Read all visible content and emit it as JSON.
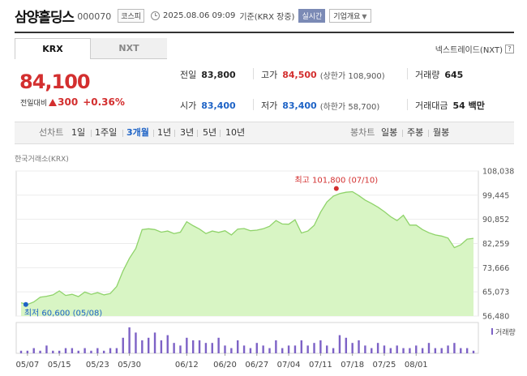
{
  "header": {
    "company": "삼양홀딩스",
    "code": "000070",
    "market": "코스피",
    "datetime": "2025.08.06 09:09",
    "basis": "기준(KRX 장중)",
    "realtime": "실시간",
    "company_info": "기업개요"
  },
  "tabs": {
    "krx": "KRX",
    "nxt": "NXT"
  },
  "nextrade": "넥스트레이드(NXT)",
  "price": {
    "current": "84,100",
    "change_label": "전일대비",
    "change": "300",
    "change_pct": "+0.36%"
  },
  "stats": {
    "prev_label": "전일",
    "prev": "83,800",
    "high_label": "고가",
    "high": "84,500",
    "upper_limit": "(상한가 108,900)",
    "volume_label": "거래량",
    "volume": "645",
    "open_label": "시가",
    "open": "83,400",
    "low_label": "저가",
    "low": "83,400",
    "lower_limit": "(하한가 58,700)",
    "amount_label": "거래대금",
    "amount": "54 백만"
  },
  "period_bar": {
    "line_label": "선차트",
    "periods": [
      "1일",
      "1주일",
      "3개월",
      "1년",
      "3년",
      "5년",
      "10년"
    ],
    "active_period": "3개월",
    "candle_label": "봉차트",
    "candles": [
      "일봉",
      "주봉",
      "월봉"
    ]
  },
  "colors": {
    "up": "#d32f2f",
    "down": "#1e63c6",
    "area": "#9be07a",
    "volume": "#7d62c6"
  },
  "chart_data": {
    "type": "area",
    "source": "한국거래소(KRX)",
    "y_ticks": [
      "108,038",
      "99,445",
      "90,852",
      "82,259",
      "73,666",
      "65,073",
      "56,480"
    ],
    "ylim": [
      56480,
      108038
    ],
    "x_ticks": [
      "05/07",
      "05/15",
      "05/23",
      "05/30",
      "06/12",
      "06/20",
      "06/27",
      "07/04",
      "07/11",
      "07/18",
      "07/25",
      "08/01"
    ],
    "series": [
      {
        "values": [
          61200,
          60600,
          61500,
          63200,
          63500,
          64000,
          65400,
          63800,
          64200,
          63400,
          65000,
          64200,
          64800,
          64000,
          64500,
          67000,
          72500,
          77000,
          80500,
          87200,
          87500,
          87200,
          86300,
          86700,
          85800,
          86300,
          90000,
          88600,
          87400,
          85800,
          86700,
          86200,
          86800,
          85300,
          87400,
          87600,
          86800,
          87000,
          87500,
          88400,
          90400,
          89200,
          89100,
          90700,
          86000,
          86700,
          88700,
          93400,
          97000,
          99100,
          100000,
          100500,
          100700,
          99300,
          97700,
          96500,
          95200,
          93600,
          91800,
          90400,
          92300,
          88800,
          88800,
          87200,
          86100,
          85300,
          84900,
          84200,
          80800,
          81800,
          83800,
          84100
        ]
      }
    ],
    "volume_label": "거래량",
    "volume": [
      1,
      1,
      2,
      1,
      3,
      1,
      1,
      2,
      2,
      1,
      2,
      1,
      2,
      1,
      2,
      2,
      6,
      10,
      8,
      5,
      6,
      8,
      5,
      7,
      4,
      3,
      6,
      5,
      5,
      4,
      4,
      6,
      3,
      2,
      5,
      3,
      2,
      4,
      3,
      2,
      5,
      2,
      3,
      3,
      5,
      3,
      4,
      5,
      3,
      2,
      7,
      6,
      4,
      5,
      3,
      2,
      4,
      3,
      2,
      3,
      2,
      2,
      3,
      2,
      4,
      2,
      2,
      3,
      4,
      2,
      2,
      1
    ],
    "annotations": {
      "high": {
        "label": "최고 101,800 (07/10)",
        "value": 101800,
        "index": 51
      },
      "low": {
        "label": "최저 60,600 (05/08)",
        "value": 60600,
        "index": 1
      }
    }
  }
}
